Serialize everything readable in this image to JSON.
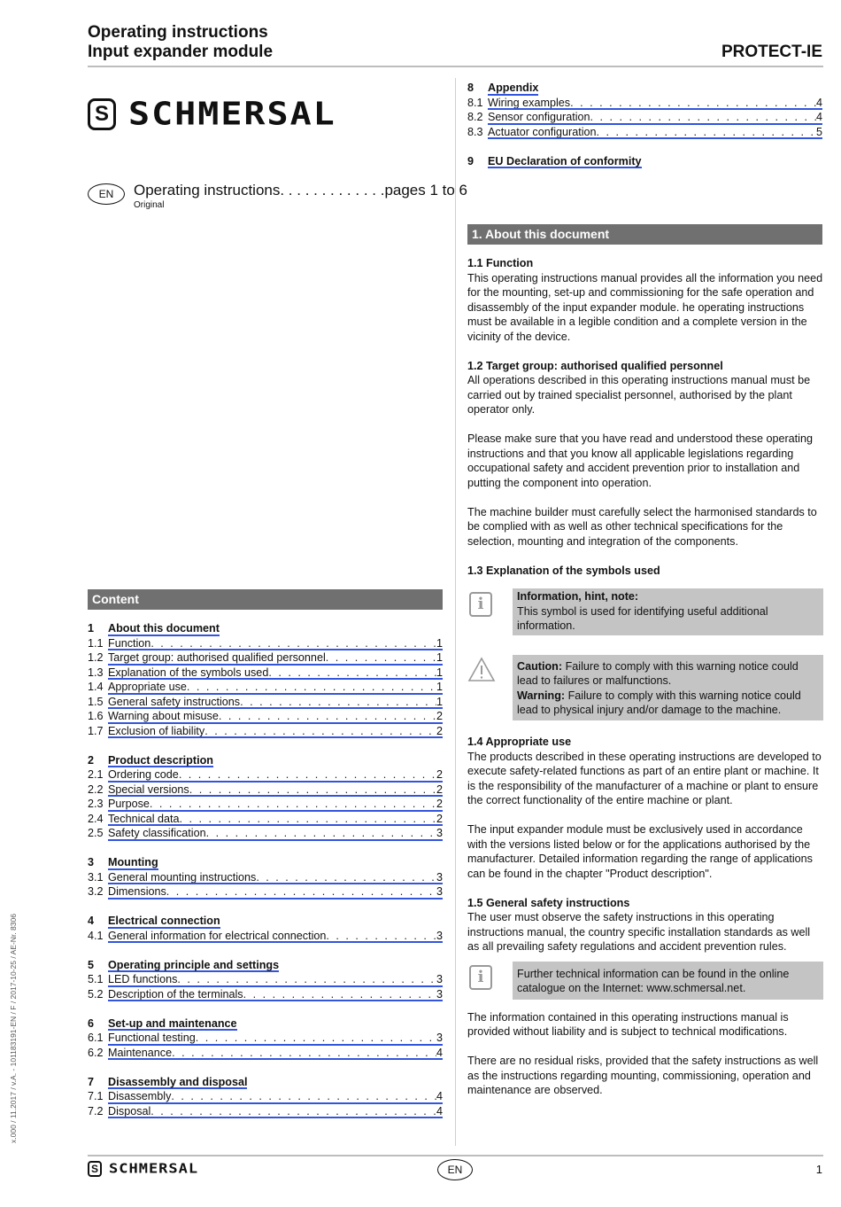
{
  "header": {
    "title_line1": "Operating instructions",
    "title_line2": "Input expander module",
    "product": "PROTECT-IE"
  },
  "brand": {
    "name": "SCHMERSAL",
    "mark": "S"
  },
  "language": {
    "code": "EN",
    "label": "Operating instructions. . . . . . . . . . . . .pages 1 to 6",
    "sub": "Original"
  },
  "toc": {
    "heading": "Content",
    "groups_left": [
      {
        "num": "1",
        "title": "About this document",
        "items": [
          {
            "num": "1.1",
            "label": "Function",
            "page": "1"
          },
          {
            "num": "1.2",
            "label": "Target group: authorised qualified personnel",
            "page": "1"
          },
          {
            "num": "1.3",
            "label": "Explanation of the symbols used",
            "page": "1"
          },
          {
            "num": "1.4",
            "label": "Appropriate use",
            "page": "1"
          },
          {
            "num": "1.5",
            "label": "General safety instructions",
            "page": "1"
          },
          {
            "num": "1.6",
            "label": "Warning about misuse",
            "page": "2"
          },
          {
            "num": "1.7",
            "label": "Exclusion of liability",
            "page": "2"
          }
        ]
      },
      {
        "num": "2",
        "title": "Product description",
        "items": [
          {
            "num": "2.1",
            "label": "Ordering code",
            "page": "2"
          },
          {
            "num": "2.2",
            "label": "Special versions",
            "page": "2"
          },
          {
            "num": "2.3",
            "label": "Purpose",
            "page": "2"
          },
          {
            "num": "2.4",
            "label": "Technical data",
            "page": "2"
          },
          {
            "num": "2.5",
            "label": "Safety classification",
            "page": "3"
          }
        ]
      },
      {
        "num": "3",
        "title": "Mounting",
        "items": [
          {
            "num": "3.1",
            "label": "General mounting instructions",
            "page": "3"
          },
          {
            "num": "3.2",
            "label": "Dimensions",
            "page": "3"
          }
        ]
      },
      {
        "num": "4",
        "title": "Electrical connection",
        "items": [
          {
            "num": "4.1",
            "label": "General information for electrical connection",
            "page": "3"
          }
        ]
      },
      {
        "num": "5",
        "title": "Operating principle and settings",
        "items": [
          {
            "num": "5.1",
            "label": "LED functions",
            "page": "3"
          },
          {
            "num": "5.2",
            "label": "Description of the terminals",
            "page": "3"
          }
        ]
      },
      {
        "num": "6",
        "title": "Set-up and maintenance",
        "items": [
          {
            "num": "6.1",
            "label": "Functional testing",
            "page": "3"
          },
          {
            "num": "6.2",
            "label": "Maintenance",
            "page": "4"
          }
        ]
      },
      {
        "num": "7",
        "title": "Disassembly and disposal",
        "items": [
          {
            "num": "7.1",
            "label": "Disassembly",
            "page": "4"
          },
          {
            "num": "7.2",
            "label": "Disposal",
            "page": "4"
          }
        ]
      }
    ],
    "groups_right": [
      {
        "num": "8",
        "title": "Appendix",
        "items": [
          {
            "num": "8.1",
            "label": "Wiring examples",
            "page": "4"
          },
          {
            "num": "8.2",
            "label": "Sensor configuration",
            "page": "4"
          },
          {
            "num": "8.3",
            "label": "Actuator configuration",
            "page": "5"
          }
        ]
      },
      {
        "num": "9",
        "title": "EU Declaration of conformity",
        "items": []
      }
    ]
  },
  "section1": {
    "bar": "1.  About this document",
    "s11_title": "1.1  Function",
    "s11_text": "This operating instructions manual provides all the information you need for the mounting, set-up and commissioning for the safe operation and disassembly of the input expander module. he operating instructions must be available in a legible condition and a complete version in the vicinity of the device.",
    "s12_title": "1.2  Target group: authorised qualified personnel",
    "s12_text1": "All operations described in this operating instructions manual must be carried out by trained specialist personnel, authorised by the plant operator only.",
    "s12_text2": "Please make sure that you have read and understood these operating instructions and that you know all applicable legislations regarding occupational safety and accident prevention prior to installation and putting the component into operation.",
    "s12_text3": "The machine builder must carefully select the harmonised standards to be complied with as well as other technical specifications for the selection, mounting and integration of the components.",
    "s13_title": "1.3  Explanation of the symbols used",
    "info_title": "Information, hint, note:",
    "info_text": "This symbol is used for identifying useful additional information.",
    "caution_label": "Caution:",
    "caution_text": " Failure to comply with this warning notice could lead to failures or malfunctions.",
    "warning_label": "Warning:",
    "warning_text": " Failure to comply with this warning notice could lead to physical injury and/or damage to the machine.",
    "s14_title": "1.4  Appropriate use",
    "s14_text1": "The products described in these operating instructions are developed to execute safety-related functions as part of an entire plant or machine. It is the responsibility of the manufacturer of a machine or plant to ensure the correct functionality of the entire machine or plant.",
    "s14_text2": "The input expander module must be exclusively used in accordance with the versions listed below or for the applications authorised by the manufacturer. Detailed information regarding the range of applications can be found in the chapter \"Product description\".",
    "s15_title": "1.5  General safety instructions",
    "s15_text1": "The user must observe the safety instructions in this operating instructions manual, the country specific installation standards as well as all prevailing safety regulations and accident prevention rules.",
    "s15_note": "Further technical information can be found in the online catalogue on the Internet: www.schmersal.net.",
    "s15_text2": "The information contained in this operating instructions manual is provided without liability and is subject to technical modifications.",
    "s15_text3": "There are no residual risks, provided that the safety instructions as well as the instructions regarding mounting, commissioning, operation and maintenance are observed."
  },
  "footer": {
    "lang": "EN",
    "page": "1",
    "side_code": "x.000 / 11.2017 / v.A.   -   101183191-EN / F / 2017-10-25 / AE-Nr. 8306"
  },
  "colors": {
    "link_underline": "#3355dd",
    "section_bar": "#707070",
    "note_box": "#c4c4c4"
  }
}
